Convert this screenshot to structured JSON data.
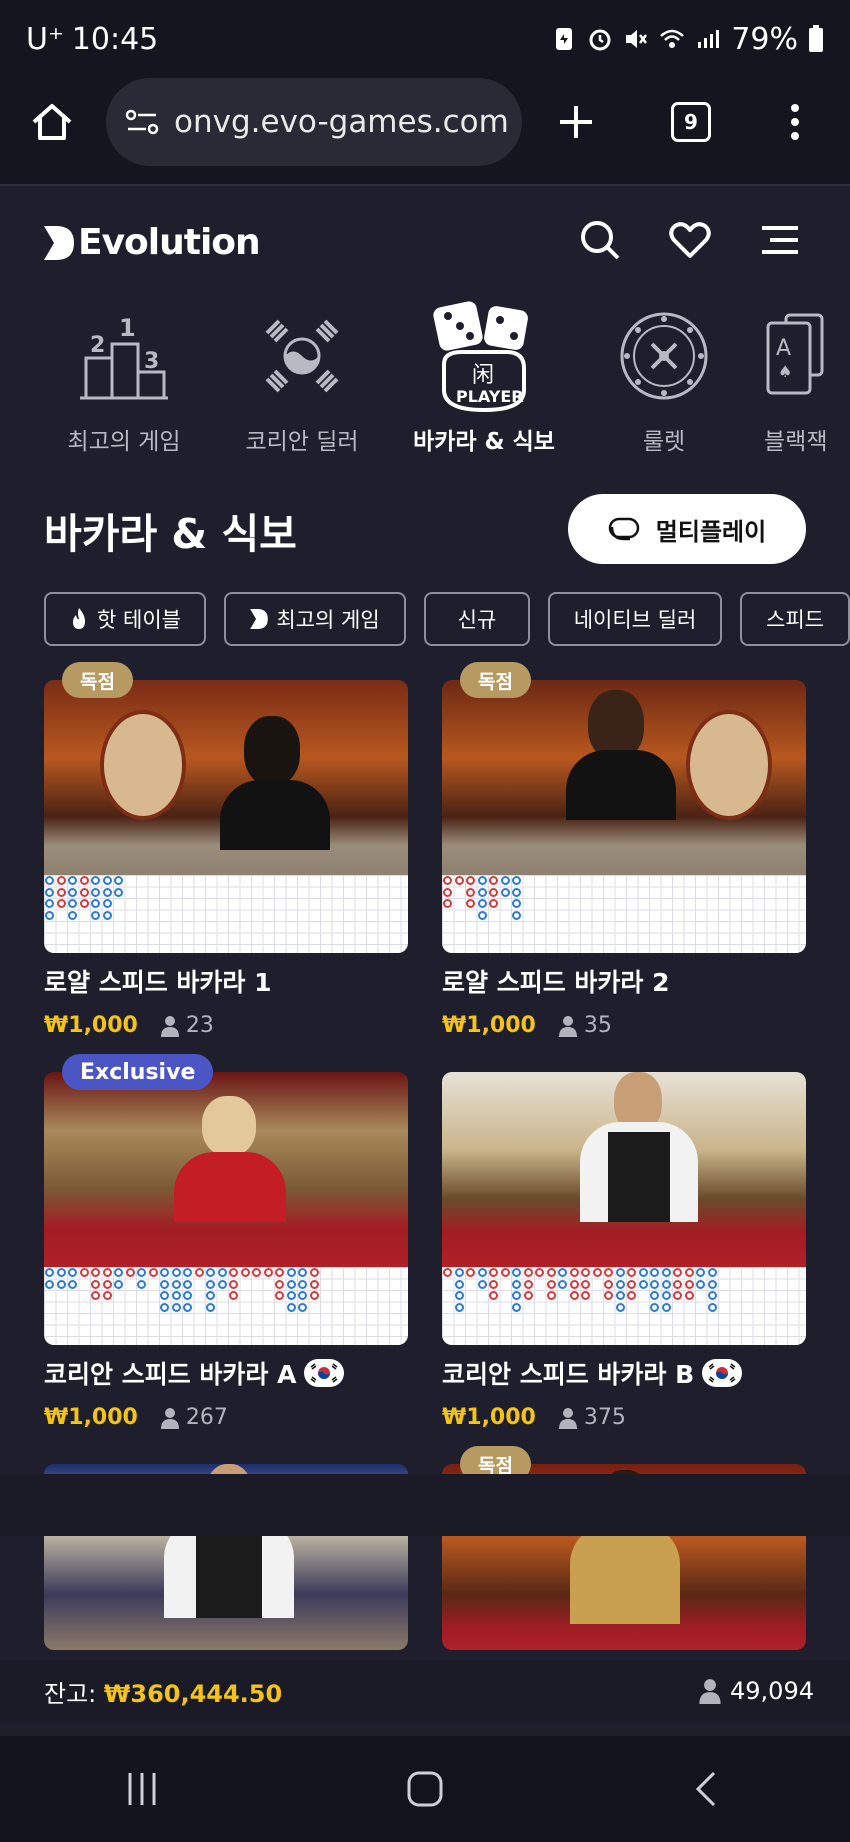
{
  "status": {
    "carrier": "U⁺",
    "time": "10:45",
    "battery": "79%"
  },
  "browser": {
    "url": "onvg.evo-games.com",
    "tabs": "9"
  },
  "header": {
    "logo": "Evolution"
  },
  "categories": [
    {
      "label": "최고의 게임",
      "icon": "podium-icon"
    },
    {
      "label": "코리안 딜러",
      "icon": "korea-flag-icon"
    },
    {
      "label": "바카라 & 식보",
      "icon": "dice-player-icon",
      "active": true
    },
    {
      "label": "룰렛",
      "icon": "roulette-icon"
    },
    {
      "label": "블랙잭",
      "icon": "card-icon"
    }
  ],
  "section": {
    "title": "바카라 & 식보",
    "multiplay": "멀티플레이"
  },
  "filters": [
    "핫 테이블",
    "최고의 게임",
    "신규",
    "네이티브 딜러",
    "스피드"
  ],
  "games": [
    {
      "name": "로얄 스피드 바카라 1",
      "price": "₩1,000",
      "players": "23",
      "badge": "독점",
      "flag": false
    },
    {
      "name": "로얄 스피드 바카라 2",
      "price": "₩1,000",
      "players": "35",
      "badge": "독점",
      "flag": false
    },
    {
      "name": "코리안 스피드 바카라 A",
      "price": "₩1,000",
      "players": "267",
      "badge": "Exclusive",
      "flag": true
    },
    {
      "name": "코리안 스피드 바카라 B",
      "price": "₩1,000",
      "players": "375",
      "badge": "",
      "flag": true
    },
    {
      "name": "",
      "price": "",
      "players": "",
      "badge": "",
      "flag": false
    },
    {
      "name": "",
      "price": "",
      "players": "",
      "badge": "독점",
      "flag": false
    }
  ],
  "footer": {
    "balance_label": "잔고:",
    "balance": "₩360,444.50",
    "online": "49,094"
  },
  "colors": {
    "accent": "#f3c318",
    "badge_gold": "#b79a62",
    "badge_blue": "#4b56c4",
    "bg": "#1e1e2c"
  }
}
